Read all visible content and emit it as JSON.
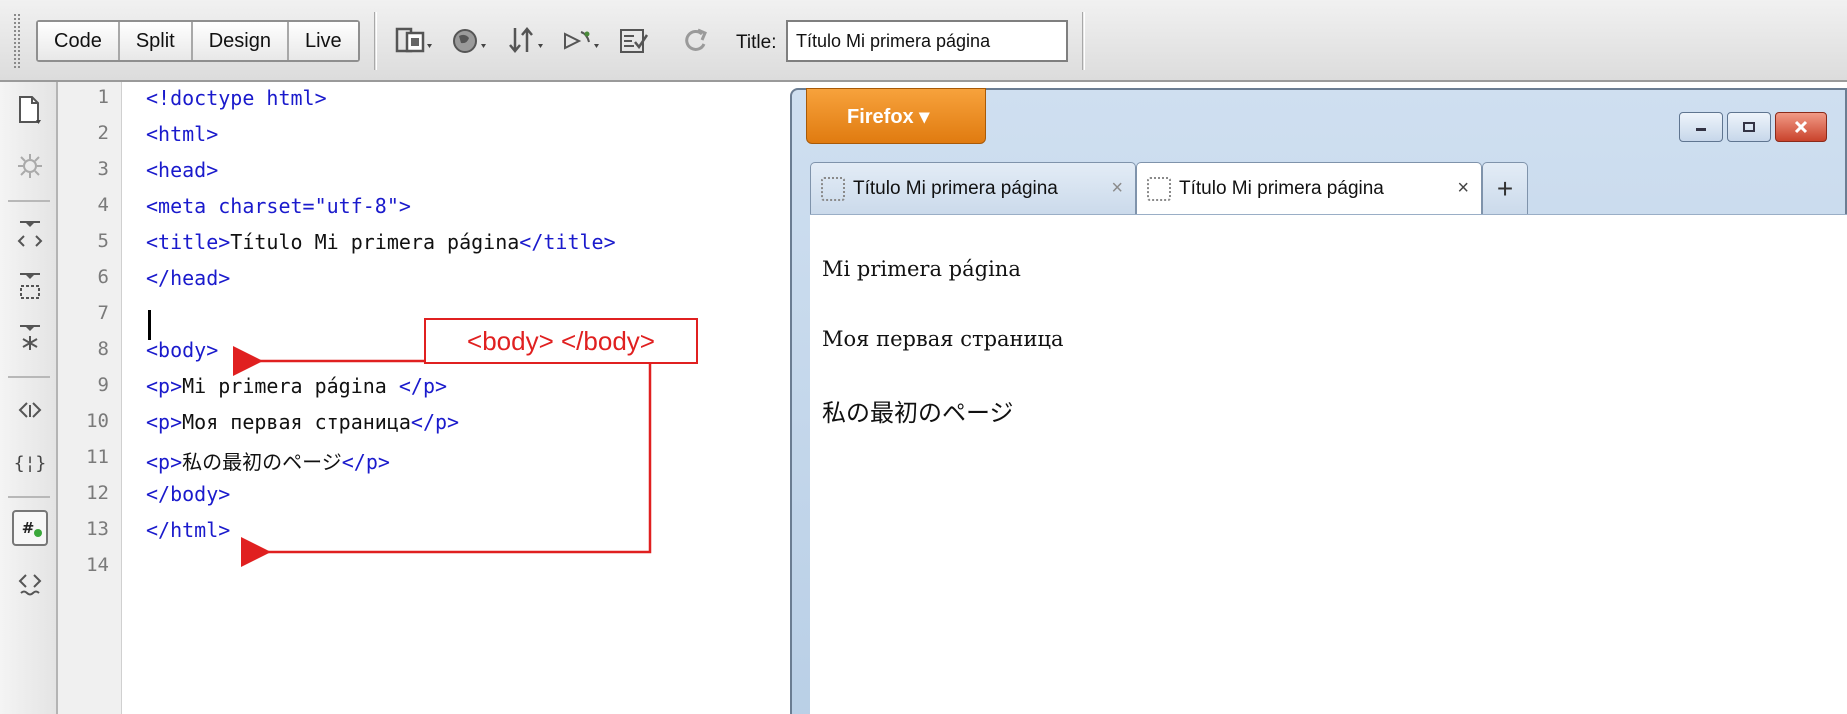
{
  "toolbar": {
    "views": [
      "Code",
      "Split",
      "Design",
      "Live"
    ],
    "title_label": "Title:",
    "title_value": "Título Mi primera página"
  },
  "editor": {
    "line_numbers": [
      "1",
      "2",
      "3",
      "4",
      "5",
      "6",
      "7",
      "8",
      "9",
      "10",
      "11",
      "12",
      "13",
      "14"
    ],
    "lines": [
      "<!doctype html>",
      "<html>",
      "<head>",
      "<meta charset=\"utf-8\">",
      "<title>Título Mi primera página</title>",
      "</head>",
      "",
      "<body>",
      "<p>Mi primera página </p>",
      "<p>Моя первая страница</p>",
      "<p>私の最初のページ</p>",
      "</body>",
      "</html>",
      ""
    ]
  },
  "annotation": {
    "label": "<body> </body>",
    "color": "#e02020"
  },
  "browser": {
    "menu_button": "Firefox ▾",
    "tabs": [
      {
        "title": "Título Mi primera página",
        "close": "×"
      },
      {
        "title": "Título Mi primera página",
        "close": "×"
      }
    ],
    "new_tab": "+",
    "content": [
      "Mi primera página",
      "Моя первая страница",
      "私の最初のページ"
    ]
  },
  "icons": {
    "toolbar": [
      "multiscreen-icon",
      "browser-preview-icon",
      "file-transfer-icon",
      "visual-aids-icon",
      "validate-icon",
      "refresh-icon"
    ],
    "rail": [
      "open-documents-icon",
      "show-code-navigator-icon",
      "collapse-tag-icon",
      "collapse-selection-icon",
      "expand-all-icon",
      "select-parent-tag-icon",
      "balance-braces-icon",
      "line-numbers-icon",
      "apply-comment-icon"
    ]
  }
}
